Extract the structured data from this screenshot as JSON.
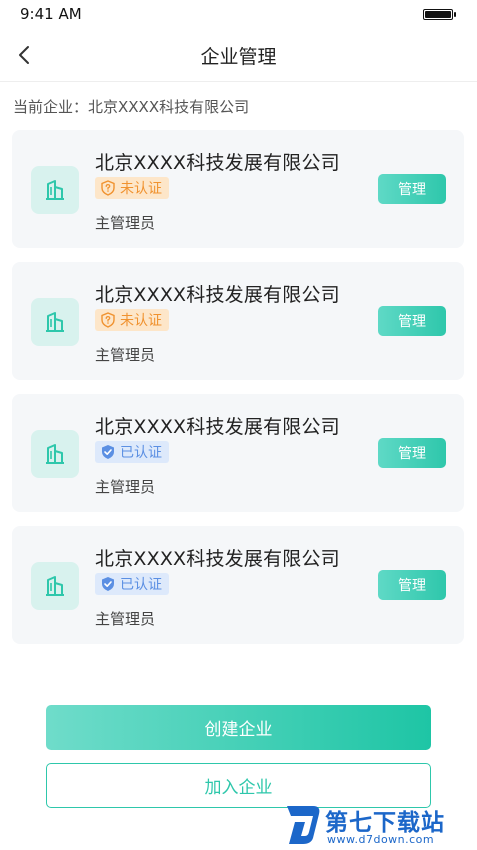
{
  "status_bar": {
    "time": "9:41 AM"
  },
  "nav": {
    "title": "企业管理",
    "back_icon": "chevron-left-icon"
  },
  "current_company_label": "当前企业：北京XXXX科技有限公司",
  "colors": {
    "accent": "#2ec7ab",
    "unverified": "#f0922f",
    "verified": "#5b8fe3",
    "card_bg": "#f5f7f9"
  },
  "companies": [
    {
      "name": "北京XXXX科技发展有限公司",
      "status": "未认证",
      "status_type": "unverified",
      "role": "主管理员",
      "manage_label": "管理"
    },
    {
      "name": "北京XXXX科技发展有限公司",
      "status": "未认证",
      "status_type": "unverified",
      "role": "主管理员",
      "manage_label": "管理"
    },
    {
      "name": "北京XXXX科技发展有限公司",
      "status": "已认证",
      "status_type": "verified",
      "role": "主管理员",
      "manage_label": "管理"
    },
    {
      "name": "北京XXXX科技发展有限公司",
      "status": "已认证",
      "status_type": "verified",
      "role": "主管理员",
      "manage_label": "管理"
    }
  ],
  "actions": {
    "create_label": "创建企业",
    "join_label": "加入企业"
  },
  "watermark": {
    "text": "第七下载站",
    "url": "www.d7down.com"
  }
}
